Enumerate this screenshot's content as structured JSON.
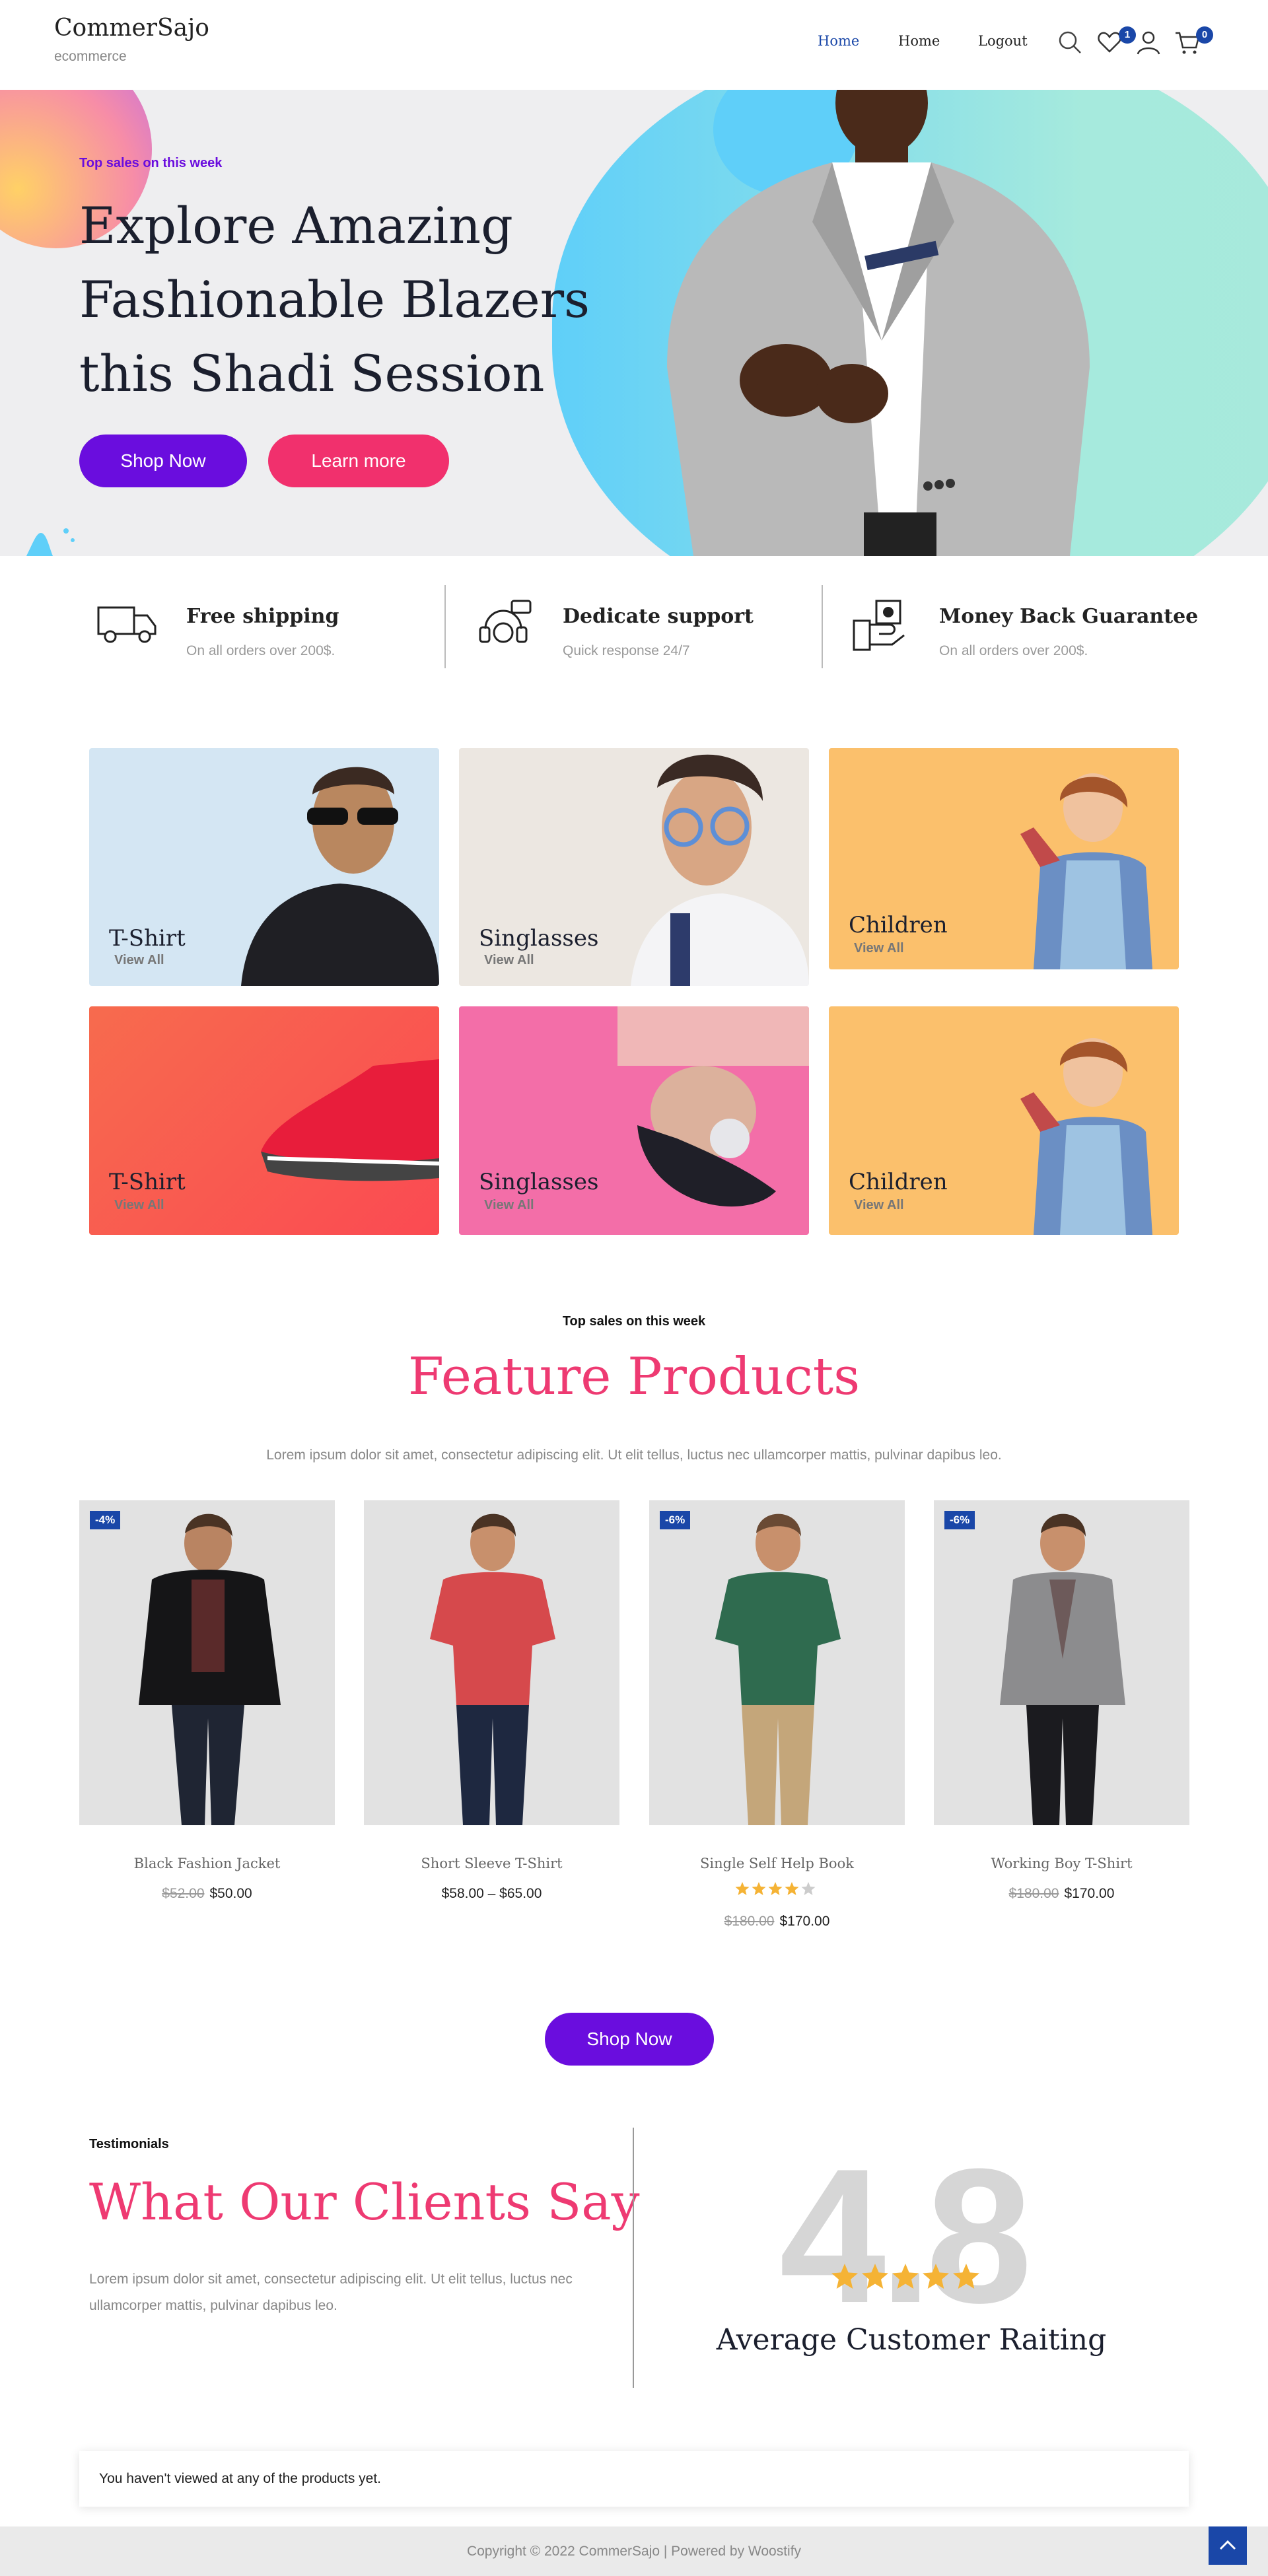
{
  "header": {
    "site_title": "CommerSajo",
    "site_tagline": "ecommerce",
    "nav": [
      "Home",
      "Home",
      "Logout"
    ],
    "wishlist_count": "1",
    "cart_count": "0"
  },
  "hero": {
    "eyebrow": "Top sales on this week",
    "title_lines": [
      "Explore Amazing",
      "Fashionable Blazers",
      "this Shadi Session"
    ],
    "primary_button": "Shop Now",
    "secondary_button": "Learn more"
  },
  "features": [
    {
      "title": "Free shipping",
      "subtitle": "On all orders over 200$.",
      "icon": "delivery-truck-icon"
    },
    {
      "title": "Dedicate support",
      "subtitle": "Quick response 24/7",
      "icon": "support-headset-icon"
    },
    {
      "title": "Money Back Guarantee",
      "subtitle": "On all orders over 200$.",
      "icon": "money-back-icon"
    }
  ],
  "categories": [
    {
      "title": "T-Shirt",
      "link": "View All"
    },
    {
      "title": "Singlasses",
      "link": "View All"
    },
    {
      "title": "Children",
      "link": "View All"
    },
    {
      "title": "T-Shirt",
      "link": "View All"
    },
    {
      "title": "Singlasses",
      "link": "View All"
    },
    {
      "title": "Children",
      "link": "View All"
    }
  ],
  "products_section": {
    "eyebrow": "Top sales on this week",
    "title": "Feature Products",
    "description": "Lorem ipsum dolor sit amet, consectetur adipiscing elit. Ut elit tellus, luctus nec ullamcorper mattis, pulvinar dapibus leo.",
    "button": "Shop Now"
  },
  "products": [
    {
      "name": "Black Fashion Jacket",
      "badge": "-4%",
      "old_price": "$52.00",
      "price": "$50.00"
    },
    {
      "name": "Short Sleeve T-Shirt",
      "badge": "",
      "old_price": "",
      "price": "$58.00 – $65.00"
    },
    {
      "name": "Single Self Help Book",
      "badge": "-6%",
      "old_price": "$180.00",
      "price": "$170.00",
      "rating": 4
    },
    {
      "name": "Working Boy T-Shirt",
      "badge": "-6%",
      "old_price": "$180.00",
      "price": "$170.00"
    }
  ],
  "testimonials": {
    "eyebrow": "Testimonials",
    "title": "What Our Clients Say",
    "description": "Lorem ipsum dolor sit amet, consectetur adipiscing elit. Ut elit tellus, luctus nec ullamcorper mattis, pulvinar dapibus leo.",
    "rating_value": "4.8",
    "rating_stars": 5,
    "rating_label": "Average Customer Raiting"
  },
  "recently_viewed": {
    "message": "You haven't viewed at any of the products yet."
  },
  "footer": {
    "copyright": "Copyright © 2022 CommerSajo | Powered by Woostify"
  },
  "colors": {
    "accent_purple": "#6a0dde",
    "accent_pink": "#ee3a72",
    "badge_blue": "#1a47a8",
    "star": "#f5b335"
  }
}
